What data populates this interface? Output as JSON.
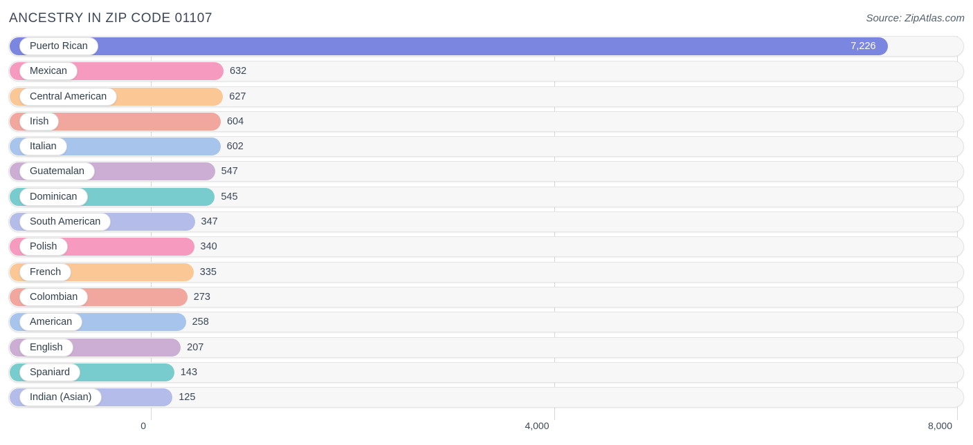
{
  "header": {
    "title": "ANCESTRY IN ZIP CODE 01107",
    "source": "Source: ZipAtlas.com"
  },
  "axis": {
    "ticks": [
      "0",
      "4,000",
      "8,000"
    ]
  },
  "chart_data": {
    "type": "bar",
    "orientation": "horizontal",
    "title": "ANCESTRY IN ZIP CODE 01107",
    "subtitle": "Source: ZipAtlas.com",
    "xlabel": "",
    "ylabel": "",
    "xlim": [
      0,
      8000
    ],
    "xticks": [
      0,
      4000,
      8000
    ],
    "xtick_labels": [
      "0",
      "4,000",
      "8,000"
    ],
    "grid": true,
    "legend": false,
    "categories": [
      "Puerto Rican",
      "Mexican",
      "Central American",
      "Irish",
      "Italian",
      "Guatemalan",
      "Dominican",
      "South American",
      "Polish",
      "French",
      "Colombian",
      "American",
      "English",
      "Spaniard",
      "Indian (Asian)"
    ],
    "values": [
      7226,
      632,
      627,
      604,
      602,
      547,
      545,
      347,
      340,
      335,
      273,
      258,
      207,
      143,
      125
    ],
    "value_labels": [
      "7,226",
      "632",
      "627",
      "604",
      "602",
      "547",
      "545",
      "347",
      "340",
      "335",
      "273",
      "258",
      "207",
      "143",
      "125"
    ],
    "colors": [
      "#7b86e0",
      "#f79ac0",
      "#fbc795",
      "#f1a79e",
      "#a7c5ec",
      "#ccadd4",
      "#79cccd",
      "#b4bdea",
      "#f79ac0",
      "#fbc795",
      "#f1a79e",
      "#a7c5ec",
      "#ccadd4",
      "#79cccd",
      "#b4bdea"
    ]
  }
}
